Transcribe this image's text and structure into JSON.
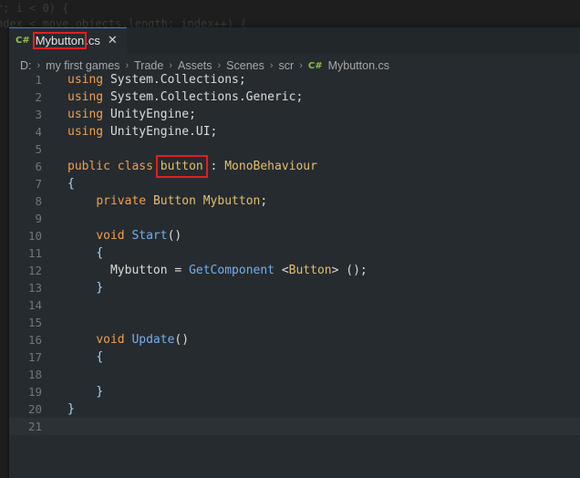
{
  "background_code": {
    "line1": "r; i < 0) {",
    "line2": "ndex < move.objects.length; index++) {"
  },
  "tab": {
    "icon": "C#",
    "name_highlight": "Mybutton",
    "name_rest": ".cs",
    "close_glyph": "✕"
  },
  "breadcrumb": {
    "items": [
      "D:",
      "my first games",
      "Trade",
      "Assets",
      "Scenes",
      "scr"
    ],
    "file_icon": "C#",
    "file": "Mybutton.cs",
    "separator": "›"
  },
  "code": {
    "line_numbers": [
      "1",
      "2",
      "3",
      "4",
      "5",
      "6",
      "7",
      "8",
      "9",
      "10",
      "11",
      "12",
      "13",
      "14",
      "15",
      "16",
      "17",
      "18",
      "19",
      "20",
      "21"
    ],
    "using_kw": "using",
    "ns1": "System.Collections",
    "ns2": "System.Collections.Generic",
    "ns3": "UnityEngine",
    "ns4": "UnityEngine.UI",
    "semicolon": ";",
    "public_kw": "public",
    "class_kw": "class",
    "class_name": "button",
    "colon": " : ",
    "base_class": "MonoBehaviour",
    "open_brace": "{",
    "close_brace": "}",
    "private_kw": "private",
    "field_type": "Button",
    "field_name": "Mybutton",
    "void_kw": "void",
    "start_fn": "Start",
    "update_fn": "Update",
    "parens": "()",
    "assign_lhs": "Mybutton",
    "assign_eq": " = ",
    "get_component": "GetComponent",
    "lt": " <",
    "gt": ">",
    "generic_type": "Button",
    "call_end": " ();"
  },
  "colors": {
    "keyword": "#f0a050",
    "type": "#e4bf6a",
    "function": "#74aef0",
    "highlight_box": "#e02020"
  }
}
